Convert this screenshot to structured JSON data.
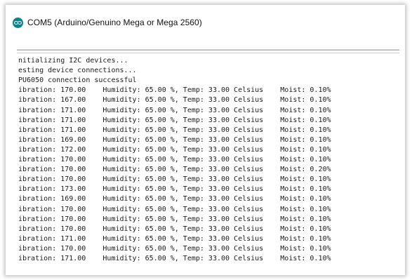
{
  "window": {
    "title": "COM5 (Arduino/Genuino Mega or Mega 2560)",
    "icon": "arduino-icon",
    "accent_color": "#00878f"
  },
  "serial_input": {
    "value": ""
  },
  "serial_output": {
    "lines": [
      "nitializing I2C devices...",
      "esting device connections...",
      "PU6050 connection successful",
      "ibration: 170.00    Humidity: 65.00 %, Temp: 33.00 Celsius    Moist: 0.10%",
      "ibration: 167.00    Humidity: 65.00 %, Temp: 33.00 Celsius    Moist: 0.10%",
      "ibration: 171.00    Humidity: 65.00 %, Temp: 33.00 Celsius    Moist: 0.10%",
      "ibration: 171.00    Humidity: 65.00 %, Temp: 33.00 Celsius    Moist: 0.10%",
      "ibration: 171.00    Humidity: 65.00 %, Temp: 33.00 Celsius    Moist: 0.10%",
      "ibration: 169.00    Humidity: 65.00 %, Temp: 33.00 Celsius    Moist: 0.10%",
      "ibration: 172.00    Humidity: 65.00 %, Temp: 33.00 Celsius    Moist: 0.10%",
      "ibration: 170.00    Humidity: 65.00 %, Temp: 33.00 Celsius    Moist: 0.10%",
      "ibration: 170.00    Humidity: 65.00 %, Temp: 33.00 Celsius    Moist: 0.20%",
      "ibration: 170.00    Humidity: 65.00 %, Temp: 33.00 Celsius    Moist: 0.10%",
      "ibration: 173.00    Humidity: 65.00 %, Temp: 33.00 Celsius    Moist: 0.10%",
      "ibration: 169.00    Humidity: 65.00 %, Temp: 33.00 Celsius    Moist: 0.10%",
      "ibration: 170.00    Humidity: 65.00 %, Temp: 33.00 Celsius    Moist: 0.10%",
      "ibration: 170.00    Humidity: 65.00 %, Temp: 33.00 Celsius    Moist: 0.10%",
      "ibration: 170.00    Humidity: 65.00 %, Temp: 33.00 Celsius    Moist: 0.10%",
      "ibration: 171.00    Humidity: 65.00 %, Temp: 33.00 Celsius    Moist: 0.10%",
      "ibration: 170.00    Humidity: 65.00 %, Temp: 33.00 Celsius    Moist: 0.10%",
      "ibration: 171.00    Humidity: 65.00 %, Temp: 33.00 Celsius    Moist: 0.10%"
    ]
  }
}
